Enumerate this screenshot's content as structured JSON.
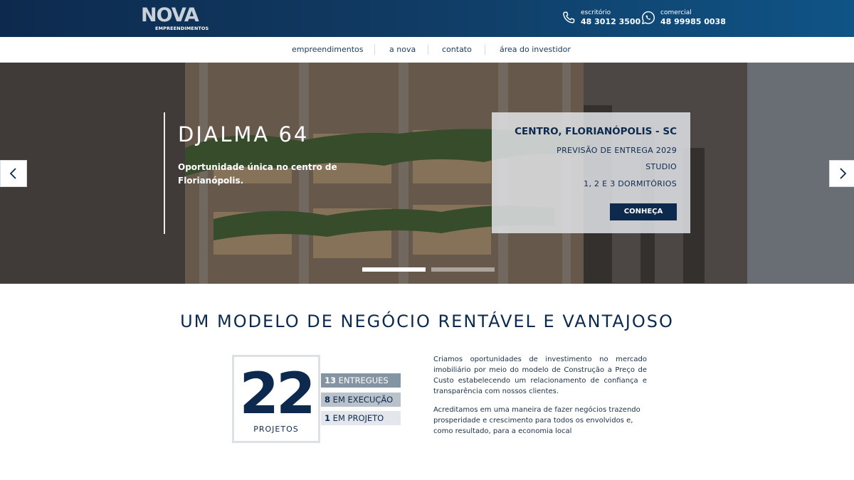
{
  "header": {
    "logo": {
      "mark": "NOVA",
      "sub": "EMPREENDIMENTOS"
    },
    "office": {
      "label": "escritório",
      "number": "48 3012 3500",
      "icon": "phone-icon"
    },
    "sales": {
      "label": "comercial",
      "number": "48 99985 0038",
      "icon": "whatsapp-icon"
    }
  },
  "nav": {
    "items": [
      {
        "label": "empreendimentos"
      },
      {
        "label": "a nova"
      },
      {
        "label": "contato"
      },
      {
        "label": "área do investidor"
      }
    ]
  },
  "hero": {
    "title": "DJALMA 64",
    "description": "Oportunidade única no centro de Florianópolis.",
    "card": {
      "location": "CENTRO, FLORIANÓPOLIS - SC",
      "lines": [
        "PREVISÃO DE ENTREGA 2029",
        "STUDIO",
        "1, 2 E 3 DORMITÓRIOS"
      ],
      "button": "CONHEÇA"
    },
    "arrows": {
      "prev": "chevron-left-icon",
      "next": "chevron-right-icon"
    },
    "slides": {
      "count": 2,
      "active": 1
    }
  },
  "section": {
    "headline": "UM MODELO DE NEGÓCIO RENTÁVEL E VANTAJOSO",
    "total": {
      "value": "22",
      "label": "PROJETOS"
    },
    "stats": [
      {
        "count": "13",
        "label": "ENTREGUES"
      },
      {
        "count": "8",
        "label": "EM EXECUÇÃO"
      },
      {
        "count": "1",
        "label": "EM PROJETO"
      }
    ],
    "paragraphs": [
      "Criamos oportunidades de investimento no mercado imobiliário por meio do modelo de Construção a Preço de Custo estabelecendo um relacionamento de confiança e transparência com nossos clientes.",
      "Acreditamos em uma maneira de fazer negócios trazendo prosperidade e crescimento para todos os envolvidos e, como resultado, para a economia local"
    ]
  },
  "colors": {
    "navy": "#0d2a4e",
    "header_gradient_end": "#0f5486",
    "card_bg": "#e2e4e8"
  }
}
